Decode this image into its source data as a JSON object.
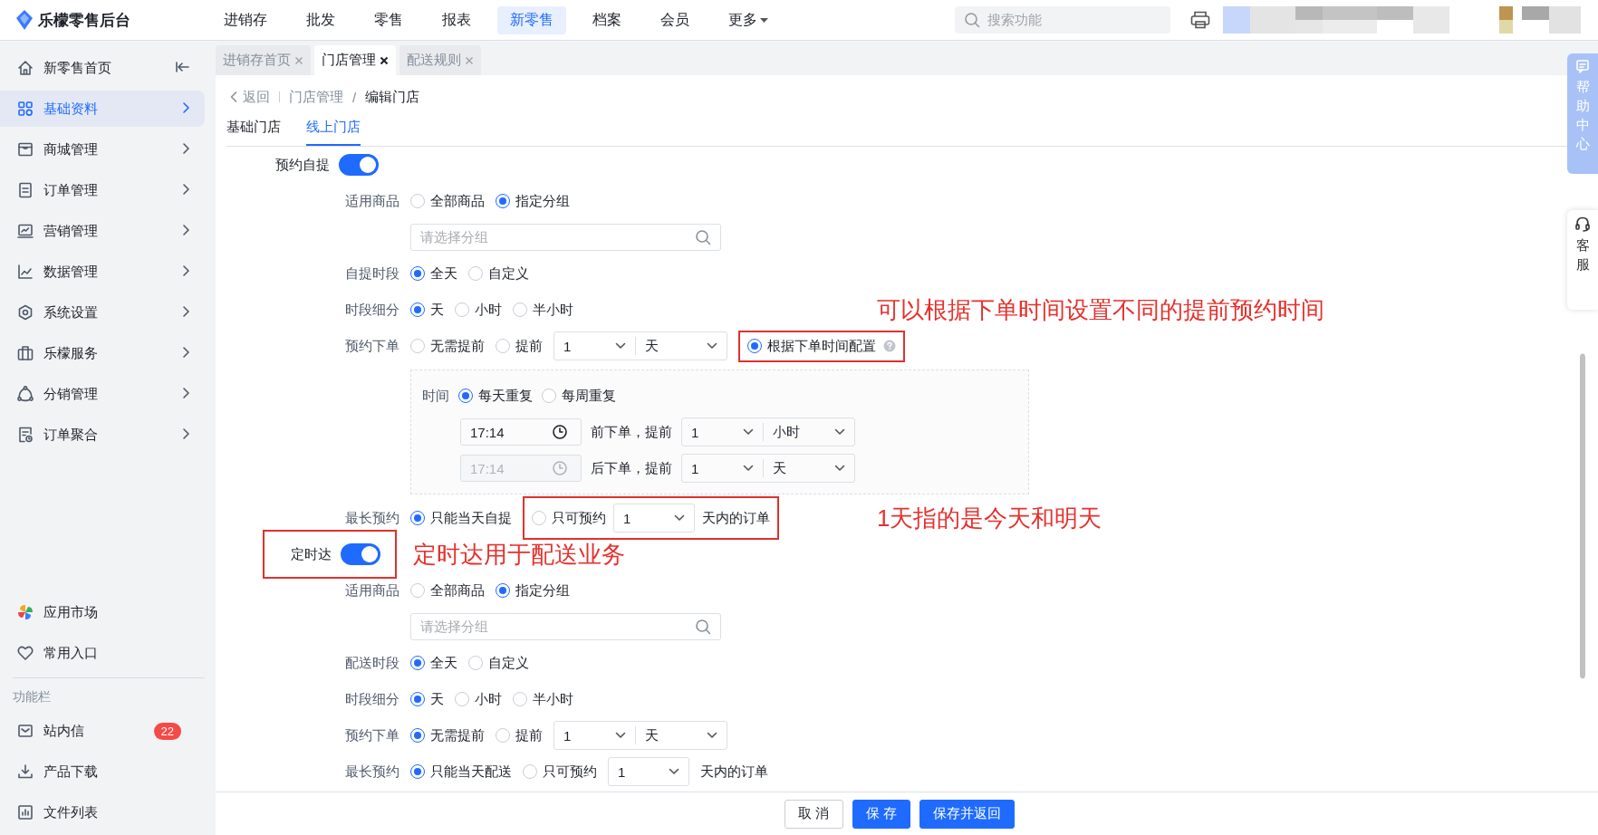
{
  "app": {
    "logo": "乐檬零售后台"
  },
  "top_nav": [
    {
      "label": "进销存",
      "selected": false,
      "has_menu": false
    },
    {
      "label": "批发",
      "selected": false,
      "has_menu": false
    },
    {
      "label": "零售",
      "selected": false,
      "has_menu": false
    },
    {
      "label": "报表",
      "selected": false,
      "has_menu": false
    },
    {
      "label": "新零售",
      "selected": true,
      "has_menu": false
    },
    {
      "label": "档案",
      "selected": false,
      "has_menu": false
    },
    {
      "label": "会员",
      "selected": false,
      "has_menu": false
    },
    {
      "label": "更多",
      "selected": false,
      "has_menu": true
    }
  ],
  "search": {
    "placeholder": "搜索功能"
  },
  "sidebar": {
    "items": [
      {
        "label": "新零售首页",
        "selected": false,
        "expandable": false
      },
      {
        "label": "基础资料",
        "selected": true,
        "expandable": true
      },
      {
        "label": "商城管理",
        "selected": false,
        "expandable": true
      },
      {
        "label": "订单管理",
        "selected": false,
        "expandable": true
      },
      {
        "label": "营销管理",
        "selected": false,
        "expandable": true
      },
      {
        "label": "数据管理",
        "selected": false,
        "expandable": true
      },
      {
        "label": "系统设置",
        "selected": false,
        "expandable": true
      },
      {
        "label": "乐檬服务",
        "selected": false,
        "expandable": true
      },
      {
        "label": "分销管理",
        "selected": false,
        "expandable": true
      },
      {
        "label": "订单聚合",
        "selected": false,
        "expandable": true
      }
    ],
    "shortcuts": [
      {
        "label": "应用市场"
      },
      {
        "label": "常用入口"
      }
    ],
    "section_title": "功能栏",
    "tools": [
      {
        "label": "站内信",
        "badge": "22"
      },
      {
        "label": "产品下载"
      },
      {
        "label": "文件列表"
      }
    ]
  },
  "page_tabs": [
    {
      "label": "进销存首页",
      "selected": false
    },
    {
      "label": "门店管理",
      "selected": true
    },
    {
      "label": "配送规则",
      "selected": false
    }
  ],
  "breadcrumb": {
    "back": "返回",
    "path": [
      "门店管理",
      "编辑门店"
    ],
    "separator": "/"
  },
  "store_tabs": [
    {
      "label": "基础门店",
      "selected": false
    },
    {
      "label": "线上门店",
      "selected": true
    }
  ],
  "sections": [
    {
      "label": "预约自提",
      "on": true,
      "highlighted": false,
      "rows": [
        {
          "kind": "field",
          "label": "适用商品",
          "items": [
            {
              "kind": "radio",
              "label": "全部商品",
              "selected": false
            },
            {
              "kind": "radio",
              "label": "指定分组",
              "selected": true
            }
          ]
        },
        {
          "kind": "field",
          "items": [
            {
              "kind": "search",
              "placeholder": "请选择分组"
            }
          ]
        },
        {
          "kind": "field",
          "label": "自提时段",
          "items": [
            {
              "kind": "radio",
              "label": "全天",
              "selected": true
            },
            {
              "kind": "radio",
              "label": "自定义",
              "selected": false
            }
          ]
        },
        {
          "kind": "field",
          "label": "时段细分",
          "items": [
            {
              "kind": "radio",
              "label": "天",
              "selected": true
            },
            {
              "kind": "radio",
              "label": "小时",
              "selected": false
            },
            {
              "kind": "radio",
              "label": "半小时",
              "selected": false
            }
          ],
          "note": "可以根据下单时间设置不同的提前预约时间"
        },
        {
          "kind": "field",
          "label": "预约下单",
          "items": [
            {
              "kind": "radio",
              "label": "无需提前",
              "selected": false
            },
            {
              "kind": "radio",
              "label": "提前",
              "selected": false
            },
            {
              "kind": "dual",
              "values": [
                "1",
                "天"
              ]
            },
            {
              "kind": "boxed",
              "items": [
                {
                  "kind": "radio",
                  "label": "根据下单时间配置",
                  "selected": true
                },
                {
                  "kind": "help"
                }
              ]
            }
          ]
        },
        {
          "kind": "panel",
          "rows": [
            {
              "label": "时间",
              "items": [
                {
                  "kind": "radio",
                  "label": "每天重复",
                  "selected": true
                },
                {
                  "kind": "radio",
                  "label": "每周重复",
                  "selected": false
                }
              ]
            },
            {
              "items": [
                {
                  "kind": "time",
                  "value": "17:14",
                  "disabled": false
                },
                {
                  "kind": "text",
                  "text": "前下单，提前"
                },
                {
                  "kind": "dual",
                  "values": [
                    "1",
                    "小时"
                  ]
                }
              ]
            },
            {
              "items": [
                {
                  "kind": "time",
                  "value": "17:14",
                  "disabled": true
                },
                {
                  "kind": "text",
                  "text": "后下单，提前"
                },
                {
                  "kind": "dual",
                  "values": [
                    "1",
                    "天"
                  ]
                }
              ]
            }
          ]
        },
        {
          "kind": "field",
          "label": "最长预约",
          "items": [
            {
              "kind": "radio",
              "label": "只能当天自提",
              "selected": true
            },
            {
              "kind": "boxed",
              "items": [
                {
                  "kind": "radio",
                  "label": "只可预约",
                  "selected": false
                },
                {
                  "kind": "select",
                  "value": "1"
                },
                {
                  "kind": "text",
                  "text": "天内的订单"
                }
              ]
            }
          ],
          "note": "1天指的是今天和明天"
        }
      ]
    },
    {
      "label": "定时达",
      "on": true,
      "highlighted": true,
      "note": "定时达用于配送业务",
      "rows": [
        {
          "kind": "field",
          "label": "适用商品",
          "items": [
            {
              "kind": "radio",
              "label": "全部商品",
              "selected": false
            },
            {
              "kind": "radio",
              "label": "指定分组",
              "selected": true
            }
          ]
        },
        {
          "kind": "field",
          "items": [
            {
              "kind": "search",
              "placeholder": "请选择分组"
            }
          ]
        },
        {
          "kind": "field",
          "label": "配送时段",
          "items": [
            {
              "kind": "radio",
              "label": "全天",
              "selected": true
            },
            {
              "kind": "radio",
              "label": "自定义",
              "selected": false
            }
          ]
        },
        {
          "kind": "field",
          "label": "时段细分",
          "items": [
            {
              "kind": "radio",
              "label": "天",
              "selected": true
            },
            {
              "kind": "radio",
              "label": "小时",
              "selected": false
            },
            {
              "kind": "radio",
              "label": "半小时",
              "selected": false
            }
          ]
        },
        {
          "kind": "field",
          "label": "预约下单",
          "items": [
            {
              "kind": "radio",
              "label": "无需提前",
              "selected": true
            },
            {
              "kind": "radio",
              "label": "提前",
              "selected": false
            },
            {
              "kind": "dual",
              "values": [
                "1",
                "天"
              ]
            }
          ]
        },
        {
          "kind": "field",
          "label": "最长预约",
          "items": [
            {
              "kind": "radio",
              "label": "只能当天配送",
              "selected": true
            },
            {
              "kind": "radio",
              "label": "只可预约",
              "selected": false
            },
            {
              "kind": "select",
              "value": "1"
            },
            {
              "kind": "text",
              "text": "天内的订单"
            }
          ]
        }
      ]
    }
  ],
  "footer_buttons": [
    {
      "label": "取 消",
      "kind": "default"
    },
    {
      "label": "保 存",
      "kind": "primary"
    },
    {
      "label": "保存并返回",
      "kind": "primary"
    }
  ],
  "side_widgets": [
    {
      "label": "帮助中心",
      "kind": "help"
    },
    {
      "label": "客服",
      "kind": "service"
    }
  ]
}
